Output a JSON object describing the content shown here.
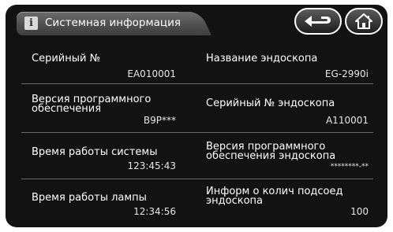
{
  "header": {
    "title": "Системная информация",
    "info_icon": "info-icon"
  },
  "nav": {
    "back_icon": "return-arrow-icon",
    "home_icon": "home-icon"
  },
  "items": [
    {
      "label": "Серийный №",
      "value": "EA010001"
    },
    {
      "label": "Название эндоскопа",
      "value": "EG-2990i"
    },
    {
      "label": "Версия программного обеспечения",
      "value": "B9P***"
    },
    {
      "label": "Серийный № эндоскопа",
      "value": "A110001"
    },
    {
      "label": "Время работы системы",
      "value": "123:45:43"
    },
    {
      "label": "Версия программного обеспечения эндоскопа",
      "value": "********-**"
    },
    {
      "label": "Время работы лампы",
      "value": "12:34:56"
    },
    {
      "label": "Информ о колич подсоед эндоскопа",
      "value": "100"
    }
  ]
}
